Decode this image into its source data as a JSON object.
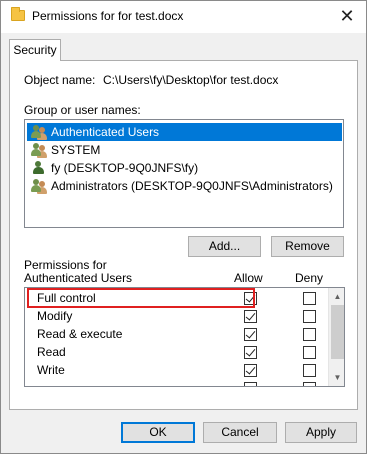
{
  "window": {
    "title": "Permissions for for test.docx",
    "close_glyph": "✕",
    "icon": "folder-icon"
  },
  "tabs": [
    {
      "label": "Security",
      "selected": true
    }
  ],
  "object": {
    "label": "Object name:",
    "value": "C:\\Users\\fy\\Desktop\\for test.docx"
  },
  "groups": {
    "label": "Group or user names:",
    "items": [
      {
        "name": "Authenticated Users",
        "icon": "users-group-icon",
        "selected": true
      },
      {
        "name": "SYSTEM",
        "icon": "users-group-icon",
        "selected": false
      },
      {
        "name": "fy (DESKTOP-9Q0JNFS\\fy)",
        "icon": "user-icon",
        "selected": false
      },
      {
        "name": "Administrators (DESKTOP-9Q0JNFS\\Administrators)",
        "icon": "users-group-icon",
        "selected": false
      }
    ],
    "add_label": "Add...",
    "remove_label": "Remove"
  },
  "permissions": {
    "label": "Permissions for Authenticated Users",
    "allow_header": "Allow",
    "deny_header": "Deny",
    "rows": [
      {
        "name": "Full control",
        "allow": true,
        "deny": false,
        "highlighted": true
      },
      {
        "name": "Modify",
        "allow": true,
        "deny": false
      },
      {
        "name": "Read & execute",
        "allow": true,
        "deny": false
      },
      {
        "name": "Read",
        "allow": true,
        "deny": false
      },
      {
        "name": "Write",
        "allow": true,
        "deny": false
      }
    ],
    "highlight_color": "#e02020"
  },
  "footer": {
    "ok_label": "OK",
    "cancel_label": "Cancel",
    "apply_label": "Apply"
  },
  "colors": {
    "selection": "#0078d7",
    "accent_border": "#0078d7"
  }
}
